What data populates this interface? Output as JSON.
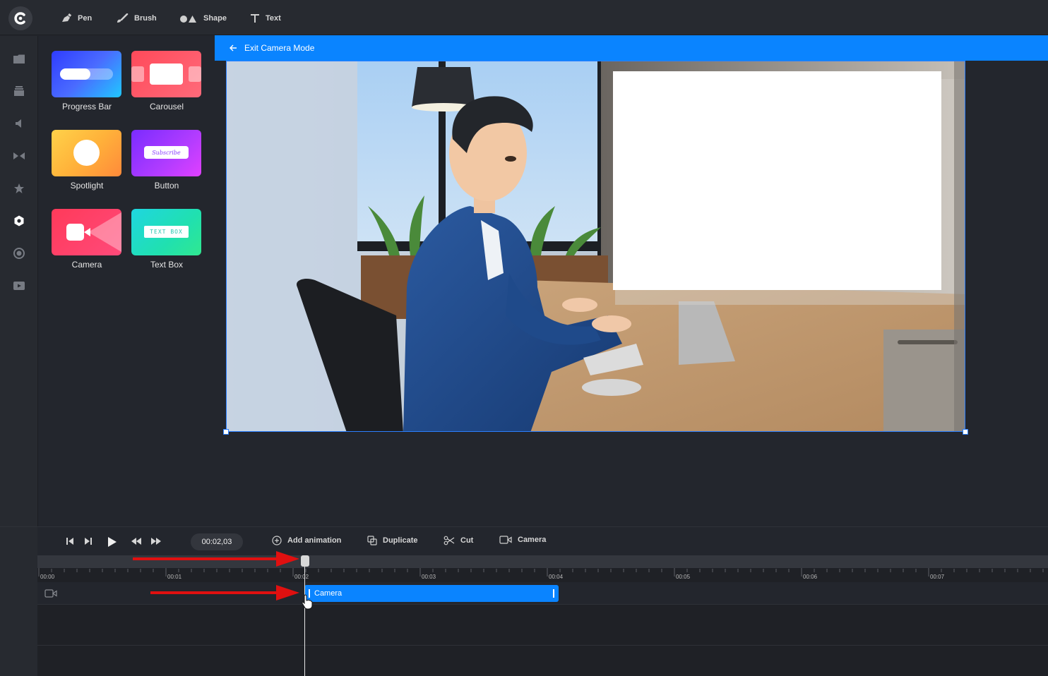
{
  "toolbar": {
    "tools": [
      {
        "label": "Pen",
        "icon": "pen-icon"
      },
      {
        "label": "Brush",
        "icon": "brush-icon"
      },
      {
        "label": "Shape",
        "icon": "shape-icon"
      },
      {
        "label": "Text",
        "icon": "text-icon"
      }
    ]
  },
  "rail": {
    "icons": [
      "folder-icon",
      "layers-icon",
      "speaker-icon",
      "transition-icon",
      "star-icon",
      "widget-icon",
      "record-icon",
      "video-icon"
    ],
    "active": "widget-icon"
  },
  "widgets": [
    {
      "label": "Progress Bar"
    },
    {
      "label": "Carousel"
    },
    {
      "label": "Spotlight"
    },
    {
      "label": "Button",
      "thumb_text": "Subscribe"
    },
    {
      "label": "Camera"
    },
    {
      "label": "Text Box",
      "thumb_text": "TEXT BOX"
    }
  ],
  "camera_mode": {
    "exit_label": "Exit Camera Mode"
  },
  "playback": {
    "timecode": "00:02,03"
  },
  "actions": {
    "add_animation": "Add animation",
    "duplicate": "Duplicate",
    "cut": "Cut",
    "camera": "Camera"
  },
  "ruler": {
    "labels": [
      "00:00",
      "00:01",
      "00:02",
      "00:03",
      "00:04",
      "00:05",
      "00:06",
      "00:07"
    ]
  },
  "track": {
    "clip_label": "Camera"
  },
  "colors": {
    "accent": "#0a84ff",
    "annotation": "#e01010"
  }
}
